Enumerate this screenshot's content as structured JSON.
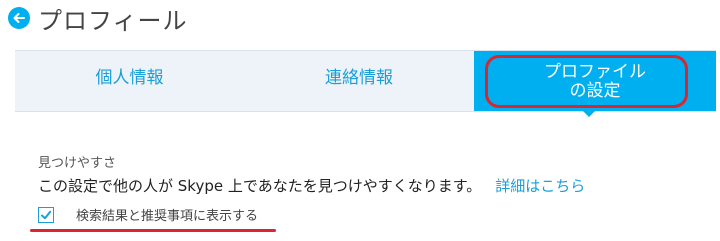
{
  "header": {
    "title": "プロフィール",
    "back_icon": "back-arrow-icon"
  },
  "tabs": [
    {
      "label": "個人情報",
      "selected": false
    },
    {
      "label": "連絡情報",
      "selected": false
    },
    {
      "label": "プロファイル\nの設定",
      "selected": true
    }
  ],
  "section": {
    "heading": "見つけやすさ",
    "description": "この設定で他の人が Skype 上であなたを見つけやすくなります。",
    "details_link": "詳細はこちら",
    "checkbox_label": "検索結果と推奨事項に表示する",
    "checkbox_checked": true
  },
  "colors": {
    "accent": "#00aff0",
    "link": "#1a9fd8",
    "annotation_red": "#d9262f",
    "tabbar_bg": "#edf3f8"
  }
}
